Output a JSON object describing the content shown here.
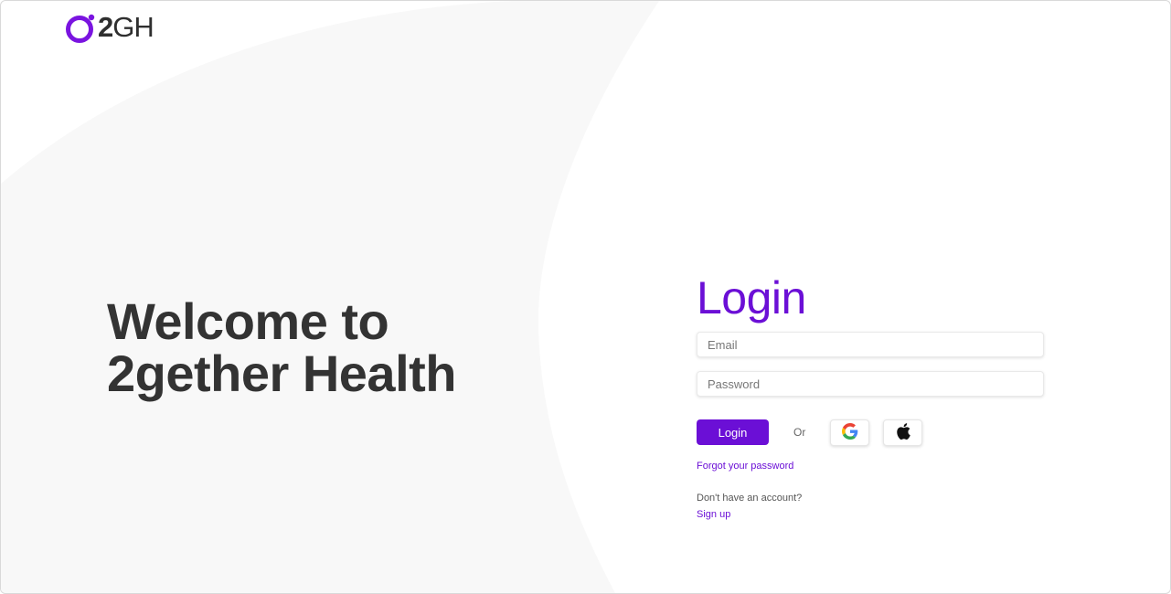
{
  "brand": {
    "logo_bold": "2",
    "logo_light": "GH",
    "accent_color": "#6b0fd6",
    "logo_icon": "ring-logo-icon"
  },
  "hero": {
    "line1": "Welcome to",
    "line2": "2gether Health"
  },
  "login": {
    "title": "Login",
    "email_placeholder": "Email",
    "password_placeholder": "Password",
    "login_button": "Login",
    "or_text": "Or",
    "google_icon": "google-icon",
    "apple_icon": "apple-icon",
    "forgot_link": "Forgot your password",
    "no_account_text": "Don't have an account?",
    "signup_link": "Sign up"
  }
}
